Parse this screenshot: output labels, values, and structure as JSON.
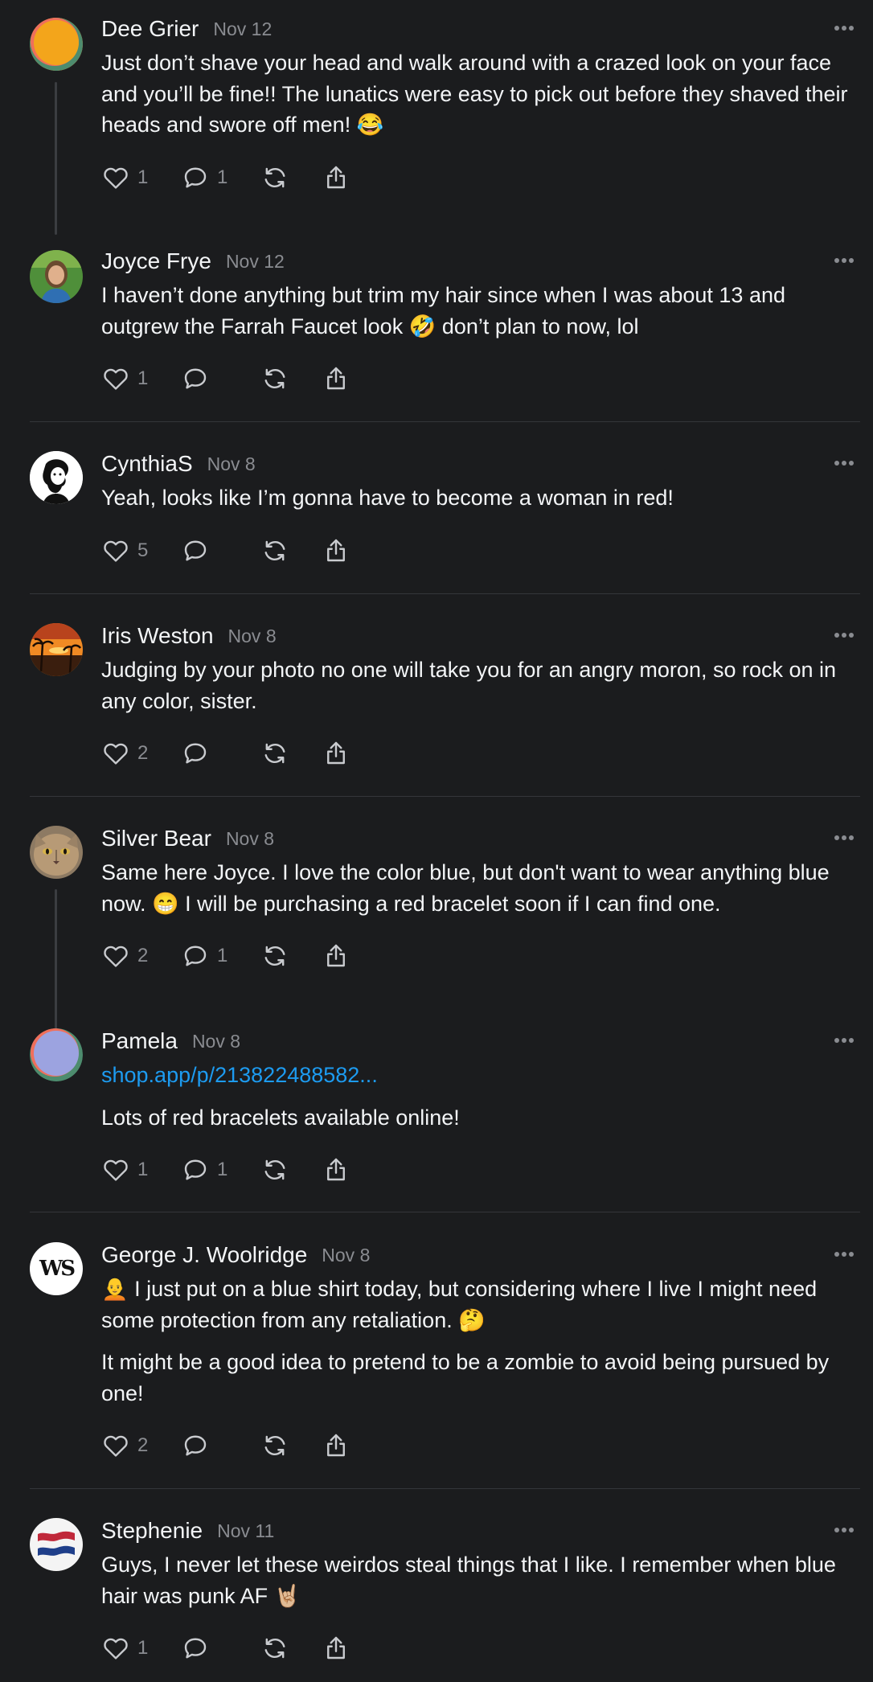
{
  "posts": [
    {
      "author": "Dee Grier",
      "date": "Nov 12",
      "paragraphs": [
        "Just don’t shave your head and walk around with a crazed look on your face and you’ll be fine!! The lunatics were easy to pick out before they shaved their heads and swore off men! 😂"
      ],
      "likes": "1",
      "replies": "1",
      "avatar": "orange-circle-avatar"
    },
    {
      "author": "Joyce Frye",
      "date": "Nov 12",
      "paragraphs": [
        "I haven’t done anything but trim my hair since when I was about 13 and outgrew the Farrah Faucet look 🤣 don’t plan to now, lol"
      ],
      "likes": "1",
      "replies": "",
      "avatar": "photo-avatar"
    },
    {
      "author": "CynthiaS",
      "date": "Nov 8",
      "paragraphs": [
        "Yeah, looks like I’m gonna have to become a woman in red!"
      ],
      "likes": "5",
      "replies": "",
      "avatar": "illustration-avatar"
    },
    {
      "author": "Iris Weston",
      "date": "Nov 8",
      "paragraphs": [
        "Judging by your photo no one will take you for an angry moron, so rock on in any color, sister."
      ],
      "likes": "2",
      "replies": "",
      "avatar": "sunset-avatar"
    },
    {
      "author": "Silver Bear",
      "date": "Nov 8",
      "paragraphs": [
        "Same here Joyce. I love the color blue, but don't want to wear anything blue now. 😁 I will be purchasing a red bracelet soon if I can find one."
      ],
      "likes": "2",
      "replies": "1",
      "avatar": "cat-avatar"
    },
    {
      "author": "Pamela",
      "date": "Nov 8",
      "link": "shop.app/p/213822488582...",
      "paragraphs": [
        "Lots of red bracelets available online!"
      ],
      "likes": "1",
      "replies": "1",
      "avatar": "lavender-circle-avatar"
    },
    {
      "author": "George J. Woolridge",
      "date": "Nov 8",
      "paragraphs": [
        "🧑‍🦲 I just put on a blue shirt today, but considering where I live I might need some protection from any retaliation. 🤔",
        "It might be a good idea to pretend to be a zombie to avoid being pursued by one!"
      ],
      "likes": "2",
      "replies": "",
      "avatar": "ws-logo-avatar",
      "avatar_text": "WS"
    },
    {
      "author": "Stephenie",
      "date": "Nov 11",
      "paragraphs": [
        "Guys, I never let these weirdos steal things that I like. I remember when blue hair was punk AF 🤘🏼"
      ],
      "likes": "1",
      "replies": "",
      "avatar": "flag-avatar"
    }
  ],
  "colors": {
    "background": "#1b1c1e",
    "text": "#f3f5f7",
    "muted": "#8a8c91",
    "link": "#1d9bf0"
  }
}
